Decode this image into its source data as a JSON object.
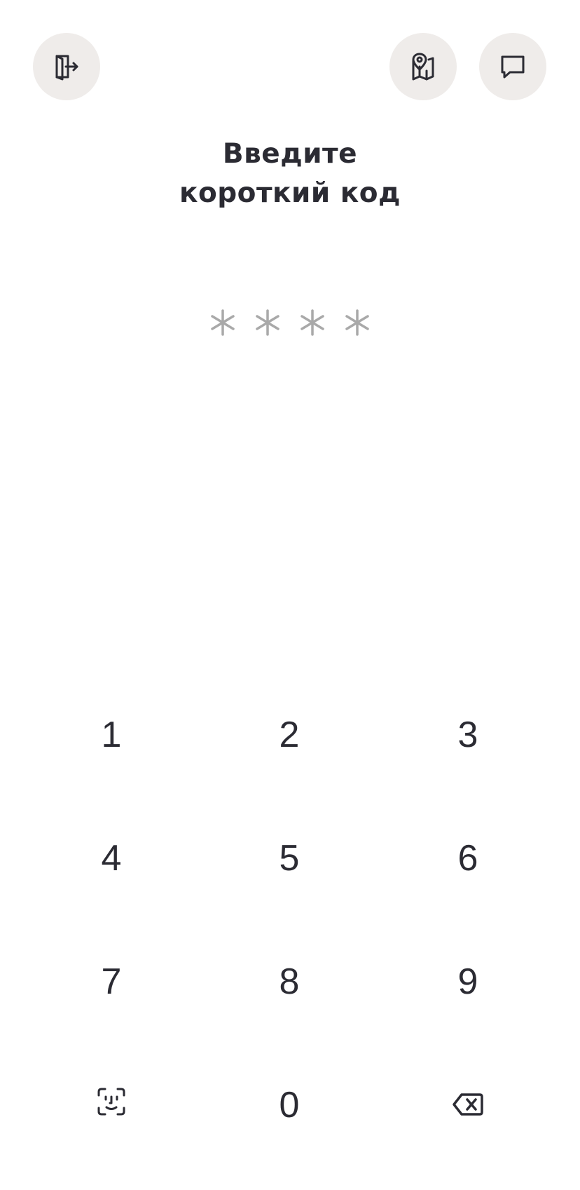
{
  "header": {
    "exit_icon": "exit-door-icon",
    "map_icon": "map-pin-icon",
    "chat_icon": "chat-bubble-icon"
  },
  "title": {
    "line1": "Введите",
    "line2": "короткий код"
  },
  "pin": {
    "length": 4,
    "entered": 0,
    "placeholder_color": "#a9a9a9"
  },
  "keypad": {
    "rows": [
      [
        "1",
        "2",
        "3"
      ],
      [
        "4",
        "5",
        "6"
      ],
      [
        "7",
        "8",
        "9"
      ]
    ],
    "bottom": {
      "left_icon": "face-id-icon",
      "zero": "0",
      "right_icon": "backspace-icon"
    }
  },
  "colors": {
    "text": "#2b2b33",
    "button_bg": "#efecea",
    "background": "#ffffff"
  }
}
